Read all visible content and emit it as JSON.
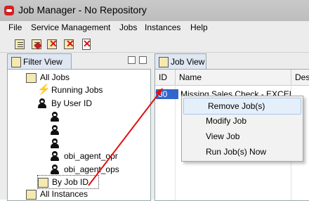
{
  "window": {
    "title": "Job Manager - No Repository",
    "accent": "#d32222"
  },
  "menu": [
    "File",
    "Service Management",
    "Jobs",
    "Instances",
    "Help"
  ],
  "toolbar": {
    "buttons": [
      "new-job-icon",
      "modify-job-icon",
      "remove-job-icon",
      "run-job-icon",
      "delete-icon"
    ]
  },
  "filter_view": {
    "tab_label": "Filter View",
    "tree": {
      "all_jobs": "All Jobs",
      "running_jobs": "Running Jobs",
      "by_user_id": "By User ID",
      "user_1": "",
      "user_2": "",
      "user_3": "",
      "user_4": "obi_agent_opr",
      "user_5": "obi_agent_ops",
      "by_job_id": "By Job ID",
      "all_instances": "All Instances"
    }
  },
  "job_view": {
    "tab_label": "Job View",
    "columns": [
      "ID",
      "Name",
      "Des"
    ],
    "rows": [
      {
        "id": "30",
        "name": "Missing Sales Check - EXCEL"
      }
    ]
  },
  "context_menu": {
    "items": [
      "Remove Job(s)",
      "Modify Job",
      "View Job",
      "Run Job(s) Now"
    ],
    "highlight_color": "#e5effa"
  },
  "annotation_color": "#e01010"
}
